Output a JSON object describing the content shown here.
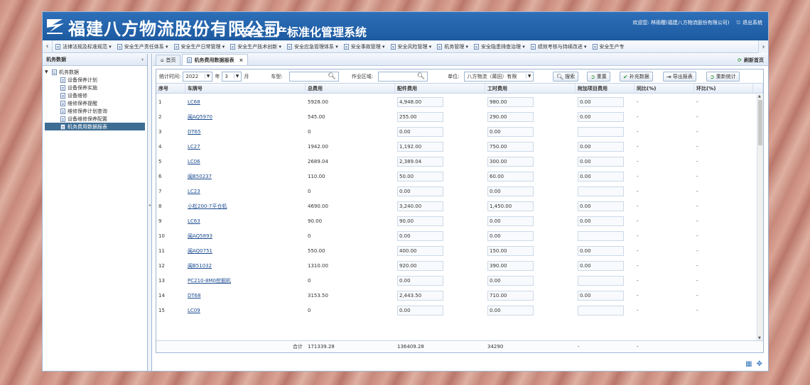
{
  "header": {
    "company": "福建八方物流股份有限公司",
    "system_title": "安全生产标准化管理系统",
    "welcome": "欢迎您: 林雨樱(福建八方物流股份有限公司)",
    "logout": "退出系统"
  },
  "nav": {
    "items": [
      "法律法规及标准规范 ▾",
      "安全生产责任体系 ▾",
      "安全生产日常管理 ▾",
      "安全生产技术创新 ▾",
      "安全应急管理体系 ▾",
      "安全事故管理 ▾",
      "安全风险管理 ▾",
      "机务管理 ▾",
      "安全隐患排查治理 ▾",
      "绩效考核与持续改进 ▾",
      "安全生产专"
    ]
  },
  "sidebar": {
    "title": "机务数据",
    "root": "机务数据",
    "items": [
      "设备保养计划",
      "设备保养实施",
      "设备维修",
      "维修保养提醒",
      "维修保养计划查询",
      "设备维修保养配置",
      "机务费用数据报表"
    ],
    "selected_index": 6
  },
  "tabs": {
    "home": "首页",
    "active": "机务费用数据报表",
    "refresh_home": "刷新首页"
  },
  "filter": {
    "time_label": "统计时间:",
    "year": "2022",
    "year_unit": "年",
    "month": "3",
    "month_unit": "月",
    "plate_label": "车型:",
    "area_label": "作业区域:",
    "unit_label": "单位:",
    "unit_value": "八方物流（莆田）有限",
    "buttons": {
      "search": "搜索",
      "reset": "重置",
      "supplement": "补充数据",
      "export": "导出报表",
      "recalc": "重新统计"
    }
  },
  "table": {
    "columns": [
      "序号",
      "车牌号",
      "总费用",
      "配件费用",
      "工时费用",
      "附加项目费用",
      "同比(%)",
      "环比(%)"
    ],
    "rows": [
      {
        "no": "1",
        "plate": "LC68",
        "total": "5928.00",
        "parts": "4,948.00",
        "labor": "980.00",
        "extra": "0.00",
        "yoy": "-",
        "mom": "-"
      },
      {
        "no": "2",
        "plate": "闽AQ5970",
        "total": "545.00",
        "parts": "255.00",
        "labor": "290.00",
        "extra": "0.00",
        "yoy": "-",
        "mom": "-"
      },
      {
        "no": "3",
        "plate": "DT65",
        "total": "0",
        "parts": "0.00",
        "labor": "0.00",
        "extra": "",
        "yoy": "-",
        "mom": "-"
      },
      {
        "no": "4",
        "plate": "LC27",
        "total": "1942.00",
        "parts": "1,192.00",
        "labor": "750.00",
        "extra": "0.00",
        "yoy": "-",
        "mom": "-"
      },
      {
        "no": "5",
        "plate": "LC06",
        "total": "2689.04",
        "parts": "2,389.04",
        "labor": "300.00",
        "extra": "0.00",
        "yoy": "-",
        "mom": "-"
      },
      {
        "no": "6",
        "plate": "闽B50237",
        "total": "110.00",
        "parts": "50.00",
        "labor": "60.00",
        "extra": "0.00",
        "yoy": "-",
        "mom": "-"
      },
      {
        "no": "7",
        "plate": "LC23",
        "total": "0",
        "parts": "0.00",
        "labor": "0.00",
        "extra": "",
        "yoy": "-",
        "mom": "-"
      },
      {
        "no": "8",
        "plate": "小松200-7平仓机",
        "total": "4690.00",
        "parts": "3,240.00",
        "labor": "1,450.00",
        "extra": "0.00",
        "yoy": "-",
        "mom": "-"
      },
      {
        "no": "9",
        "plate": "LC63",
        "total": "90.00",
        "parts": "90.00",
        "labor": "0.00",
        "extra": "0.00",
        "yoy": "-",
        "mom": "-"
      },
      {
        "no": "10",
        "plate": "闽AQ5893",
        "total": "0",
        "parts": "0.00",
        "labor": "0.00",
        "extra": "",
        "yoy": "-",
        "mom": "-"
      },
      {
        "no": "11",
        "plate": "闽AQ0751",
        "total": "550.00",
        "parts": "400.00",
        "labor": "150.00",
        "extra": "0.00",
        "yoy": "-",
        "mom": "-"
      },
      {
        "no": "12",
        "plate": "闽B51032",
        "total": "1310.00",
        "parts": "920.00",
        "labor": "390.00",
        "extra": "0.00",
        "yoy": "-",
        "mom": "-"
      },
      {
        "no": "13",
        "plate": "PC210-8M0挖掘机",
        "total": "0",
        "parts": "0.00",
        "labor": "0.00",
        "extra": "",
        "yoy": "-",
        "mom": "-"
      },
      {
        "no": "14",
        "plate": "DT68",
        "total": "3153.50",
        "parts": "2,443.50",
        "labor": "710.00",
        "extra": "0.00",
        "yoy": "-",
        "mom": "-"
      },
      {
        "no": "15",
        "plate": "LC09",
        "total": "0",
        "parts": "0.00",
        "labor": "0.00",
        "extra": "",
        "yoy": "-",
        "mom": "-"
      }
    ],
    "footer": {
      "label": "合计",
      "total": "171339.28",
      "parts": "136409.28",
      "labor": "34290",
      "extra": "-",
      "yoy": "-"
    }
  },
  "colors": {
    "header_blue": "#1d5aa0",
    "selected_row": "#3d6d93",
    "link": "#1a4b8f"
  }
}
